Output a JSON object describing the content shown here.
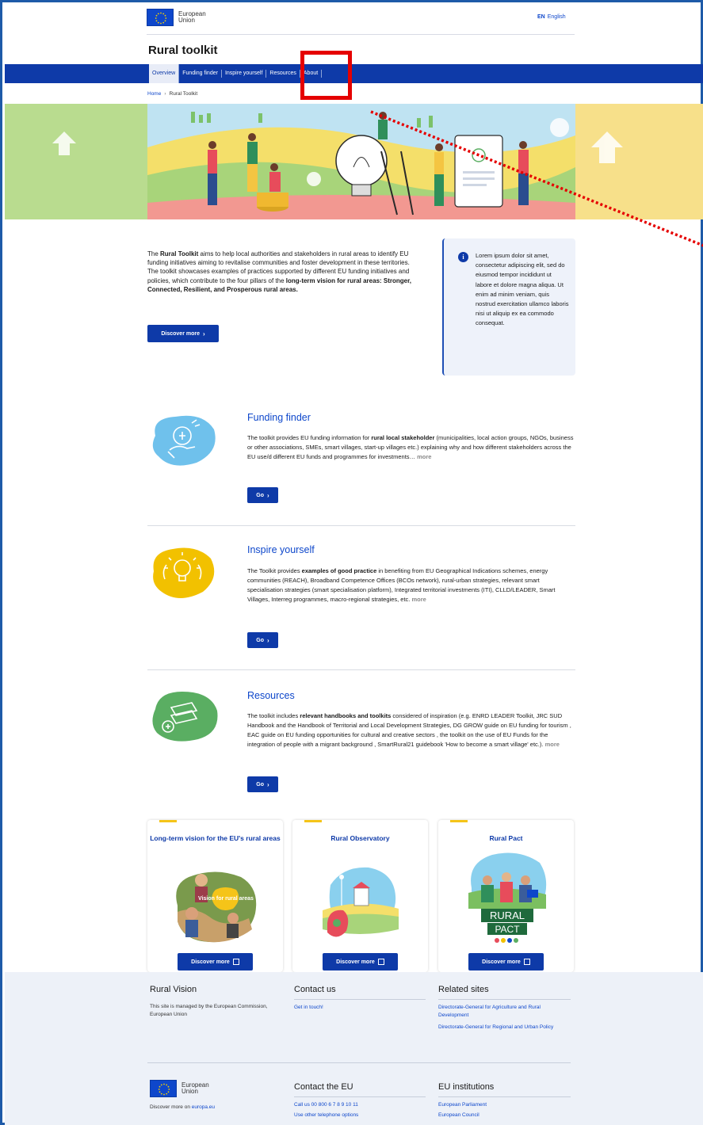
{
  "header": {
    "logo_line1": "European",
    "logo_line2": "Union",
    "lang_code": "EN",
    "lang_name": "English",
    "site_title": "Rural toolkit"
  },
  "nav": {
    "items": [
      "Overview",
      "Funding finder",
      "Inspire yourself",
      "Resources",
      "About"
    ]
  },
  "breadcrumb": {
    "home": "Home",
    "current": "Rural Toolkit"
  },
  "intro": {
    "p1": "The ",
    "p1_bold": "Rural Toolkit",
    "p2": " aims to help local authorities and stakeholders in rural areas to identify EU funding initiatives aiming to revitalise communities and foster development in these territories. The toolkit showcases examples of practices supported by different EU funding initiatives and policies, which contribute to the four pillars of the ",
    "p2_bold": "long-term vision for rural areas: Stronger, Connected, Resilient, and Prosperous rural areas.",
    "button": "Discover more"
  },
  "infobox": {
    "icon": "i",
    "text": "Lorem ipsum dolor sit amet, consectetur adipiscing elit, sed do eiusmod tempor incididunt ut labore et dolore magna aliqua. Ut enim ad minim veniam, quis nostrud exercitation ullamco laboris nisi ut aliquip ex ea commodo consequat."
  },
  "sections": [
    {
      "title": "Funding finder",
      "t1": "The toolkit provides EU funding information for ",
      "b1": "rural local stakeholder",
      "t2": " (municipalities, local action groups, NGOs, business or other associations, SMEs, smart villages, start-up villages etc.) explaining why and how different stakeholders across the EU use/d different EU funds and programmes for investments…",
      "more": "more",
      "button": "Go",
      "color": "#6fc1ec"
    },
    {
      "title": "Inspire yourself",
      "t1": "The Toolkit provides ",
      "b1": "examples of good practice",
      "t2": " in benefiting from EU Geographical Indications schemes, energy communities (REACH), Broadband Competence Offices (BCOs network), rural-urban strategies, relevant smart specialisation strategies (smart specialisation platform), Integrated territorial investments (ITI), CLLD/LEADER, Smart Villages, Interreg programmes, macro-regional strategies, etc.",
      "more": "more",
      "button": "Go",
      "color": "#f2c100"
    },
    {
      "title": "Resources",
      "t1": "The toolkit includes ",
      "b1": "relevant handbooks and toolkits",
      "t2": " considered of inspiration (e.g. ENRD LEADER Toolkit, JRC SUD Handbook and the Handbook of Territorial and Local Development Strategies, DG GROW guide on EU funding for tourism , EAC guide on EU funding opportunities for cultural and creative sectors , the toolkit on the use of EU Funds for the integration of people with a migrant background , SmartRural21 guidebook 'How to become a smart village' etc.).",
      "more": "more",
      "button": "Go",
      "color": "#5aae62"
    }
  ],
  "cards": [
    {
      "title": "Long-term vision for the EU's rural areas",
      "button": "Discover more",
      "image_text": "Vision for rural areas"
    },
    {
      "title": "Rural Observatory",
      "button": "Discover more"
    },
    {
      "title": "Rural Pact",
      "button": "Discover more",
      "image_text_1": "RURAL",
      "image_text_2": "PACT"
    }
  ],
  "footer": {
    "col1_title": "Rural Vision",
    "col1_text": "This site is managed by the European Commission, European Union",
    "col2_title": "Contact us",
    "col2_link": "Get in touch!",
    "col3_title": "Related sites",
    "col3_link1": "Directorate-General for Agriculture and Rural Development",
    "col3_link2": "Directorate-General for Regional and Urban Policy",
    "eu_line1": "European",
    "eu_line2": "Union",
    "eu_discover": "Discover more on ",
    "eu_discover_link": "europa.eu",
    "col5_title": "Contact the EU",
    "col5_link1": "Call us 00 800 6 7 8 9 10 11",
    "col5_link2": "Use other telephone options",
    "col6_title": "EU institutions",
    "col6_link1": "European Parliament",
    "col6_link2": "European Council"
  },
  "colors": {
    "primary": "#0e3aa8",
    "link": "#0e47cb",
    "highlight": "#e50000",
    "hero_bg": "#f7eaa0",
    "accent_yellow": "#f5c419"
  }
}
